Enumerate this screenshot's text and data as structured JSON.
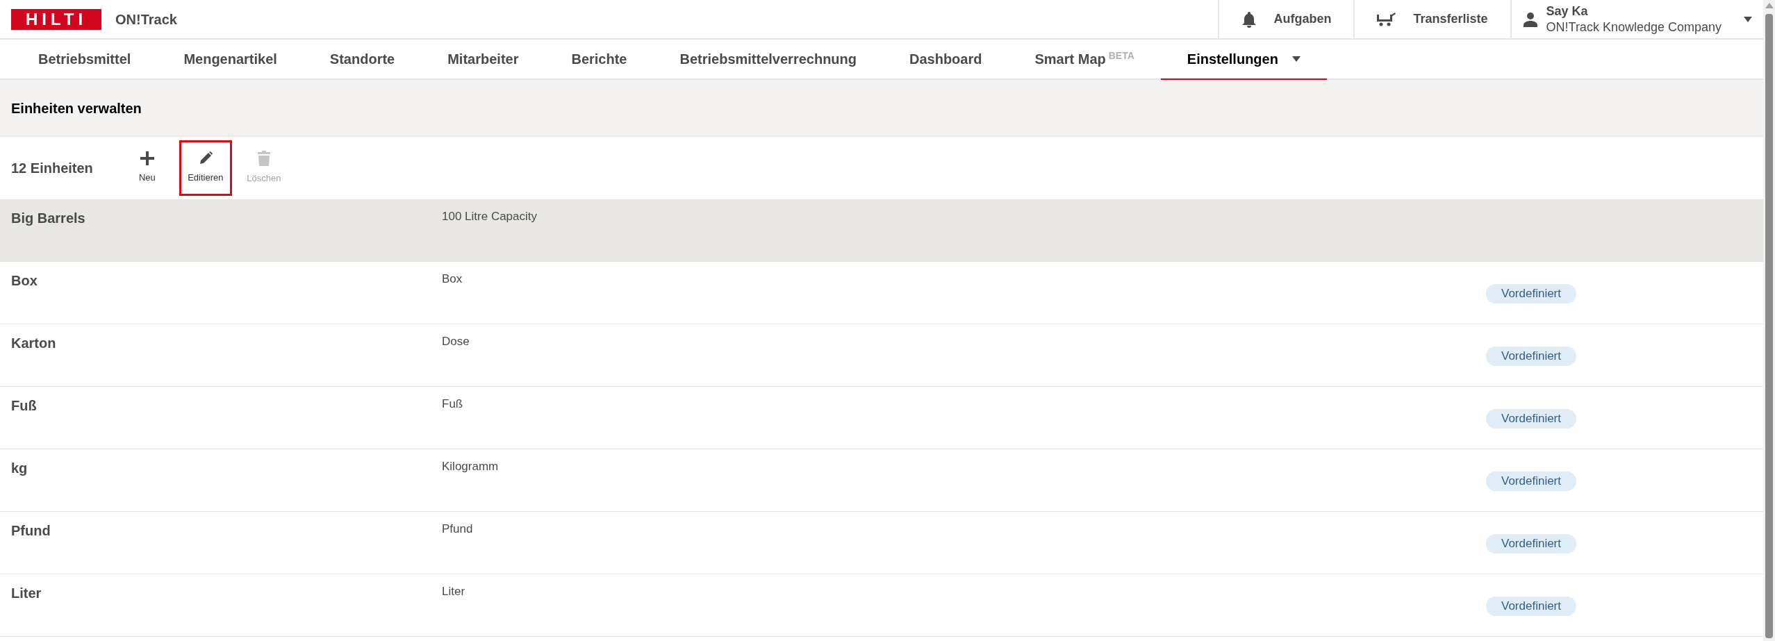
{
  "header": {
    "logo": "HILTI",
    "app_name": "ON!Track",
    "actions": [
      {
        "kind": "bell",
        "label": "Aufgaben"
      },
      {
        "kind": "cart",
        "label": "Transferliste"
      }
    ],
    "user": {
      "name": "Say Ka",
      "company": "ON!Track Knowledge Company"
    }
  },
  "nav": [
    {
      "label": "Betriebsmittel",
      "selected": false
    },
    {
      "label": "Mengenartikel",
      "selected": false
    },
    {
      "label": "Standorte",
      "selected": false
    },
    {
      "label": "Mitarbeiter",
      "selected": false
    },
    {
      "label": "Berichte",
      "selected": false
    },
    {
      "label": "Betriebsmittelverrechnung",
      "selected": false
    },
    {
      "label": "Dashboard",
      "selected": false
    },
    {
      "label": "Smart Map",
      "sup": "BETA",
      "selected": false
    },
    {
      "label": "Einstellungen",
      "dropdown": true,
      "selected": true
    }
  ],
  "section_title": "Einheiten verwalten",
  "toolbar": {
    "count": "12 Einheiten",
    "buttons": [
      {
        "kind": "plus",
        "label": "Neu",
        "disabled": false,
        "highlighted": false
      },
      {
        "kind": "pencil",
        "label": "Editieren",
        "disabled": false,
        "highlighted": true
      },
      {
        "kind": "trash",
        "label": "Löschen",
        "disabled": true,
        "highlighted": false
      }
    ]
  },
  "rows": [
    {
      "name": "Big Barrels",
      "description": "100 Litre Capacity",
      "selected": true
    },
    {
      "name": "Box",
      "description": "Box",
      "badge": "Vordefiniert",
      "selected": false
    },
    {
      "name": "Karton",
      "description": "Dose",
      "badge": "Vordefiniert",
      "selected": false
    },
    {
      "name": "Fuß",
      "description": "Fuß",
      "badge": "Vordefiniert",
      "selected": false
    },
    {
      "name": "kg",
      "description": "Kilogramm",
      "badge": "Vordefiniert",
      "selected": false
    },
    {
      "name": "Pfund",
      "description": "Pfund",
      "badge": "Vordefiniert",
      "selected": false
    },
    {
      "name": "Liter",
      "description": "Liter",
      "badge": "Vordefiniert",
      "selected": false
    }
  ]
}
